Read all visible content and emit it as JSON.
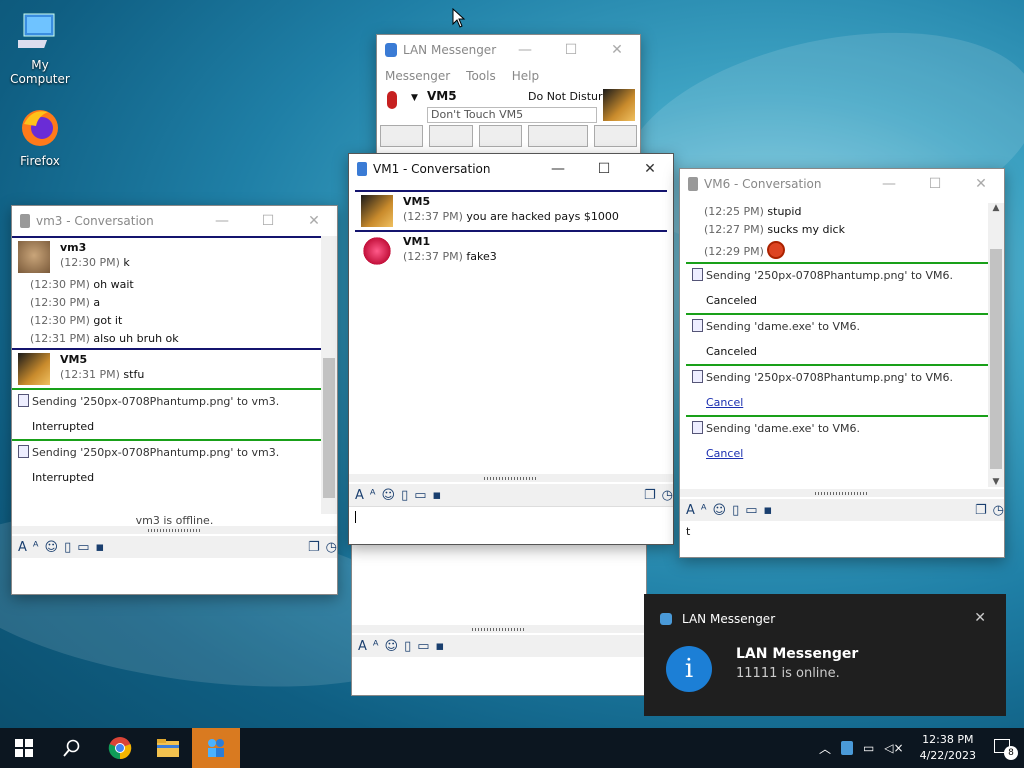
{
  "desktop": {
    "icons": [
      {
        "label": "My Computer"
      },
      {
        "label": "Firefox"
      }
    ]
  },
  "main_window": {
    "title": "LAN Messenger",
    "menu": [
      "Messenger",
      "Tools",
      "Help"
    ],
    "user_name": "VM5",
    "status": "Do Not Disturb",
    "note": "Don't Touch VM5"
  },
  "vm3_window": {
    "title": "vm3 - Conversation",
    "messages": [
      {
        "sender": "vm3",
        "lines": [
          {
            "time": "(12:30 PM)",
            "text": "k"
          },
          {
            "time": "(12:30 PM)",
            "text": "oh wait"
          },
          {
            "time": "(12:30 PM)",
            "text": "a"
          },
          {
            "time": "(12:30 PM)",
            "text": "got it"
          },
          {
            "time": "(12:31 PM)",
            "text": "also uh bruh ok"
          }
        ]
      },
      {
        "sender": "VM5",
        "lines": [
          {
            "time": "(12:31 PM)",
            "text": "stfu"
          }
        ]
      }
    ],
    "transfers": [
      {
        "text": "Sending '250px-0708Phantump.png' to vm3.",
        "status": "Interrupted"
      },
      {
        "text": "Sending '250px-0708Phantump.png' to vm3.",
        "status": "Interrupted"
      }
    ],
    "status_text": "vm3 is offline."
  },
  "vm1_window": {
    "title": "VM1 - Conversation",
    "messages": [
      {
        "sender": "VM5",
        "time": "(12:37 PM)",
        "text": "you are hacked pays $1000"
      },
      {
        "sender": "VM1",
        "time": "(12:37 PM)",
        "text": "fake3"
      }
    ],
    "input_value": ""
  },
  "vm6_window": {
    "title": "VM6 - Conversation",
    "lines": [
      {
        "time": "(12:25 PM)",
        "text": "stupid"
      },
      {
        "time": "(12:27 PM)",
        "text": "sucks my dick"
      },
      {
        "time": "(12:29 PM)",
        "text": ""
      }
    ],
    "transfers": [
      {
        "text": "Sending '250px-0708Phantump.png' to VM6.",
        "status": "Canceled",
        "is_link": false
      },
      {
        "text": "Sending 'dame.exe' to VM6.",
        "status": "Canceled",
        "is_link": false
      },
      {
        "text": "Sending '250px-0708Phantump.png' to VM6.",
        "status": "Cancel",
        "is_link": true
      },
      {
        "text": "Sending 'dame.exe' to VM6.",
        "status": "Cancel",
        "is_link": true
      }
    ],
    "input_value": "t"
  },
  "toast": {
    "app": "LAN Messenger",
    "title": "LAN Messenger",
    "body": "11111 is online."
  },
  "taskbar": {
    "time": "12:38 PM",
    "date": "4/22/2023",
    "notification_count": "8"
  },
  "colors": {
    "accent": "#1c7fd6",
    "msg_divider": "#14146e",
    "transfer_divider": "#19a019",
    "taskbar": "#0c1620"
  }
}
